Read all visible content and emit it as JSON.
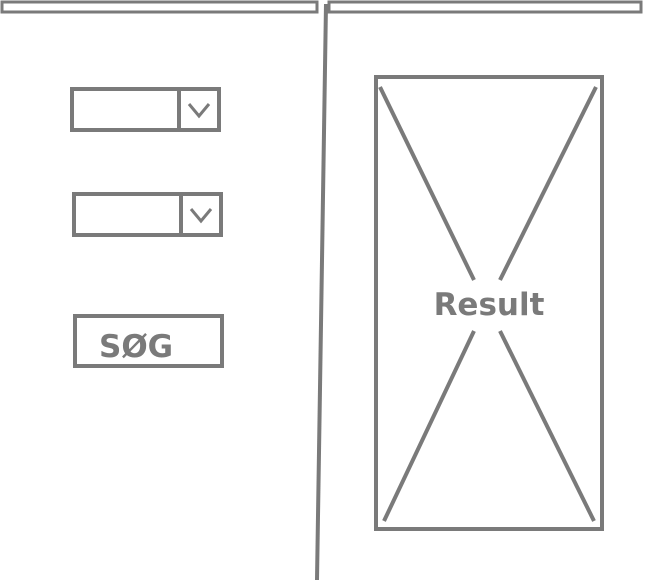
{
  "search_button": {
    "label": "SØG"
  },
  "dropdowns": [
    {
      "value": ""
    },
    {
      "value": ""
    }
  ],
  "result": {
    "label": "Result"
  },
  "icons": {
    "dropdown_toggle": "chevron-down-icon",
    "result_placeholder": "image-placeholder-icon"
  },
  "colors": {
    "stroke": "#7a7a7a",
    "background": "#ffffff"
  }
}
